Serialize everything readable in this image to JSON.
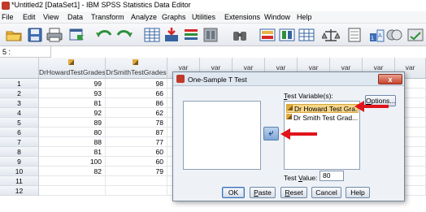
{
  "window": {
    "title": "*Untitled2 [DataSet1] - IBM SPSS Statistics Data Editor"
  },
  "menu": [
    "File",
    "Edit",
    "View",
    "Data",
    "Transform",
    "Analyze",
    "Graphs",
    "Utilities",
    "Extensions",
    "Window",
    "Help"
  ],
  "toolbar_icons": [
    "open-folder-icon",
    "save-icon",
    "print-icon",
    "recall-dialog-icon",
    "undo-icon",
    "redo-icon",
    "goto-case-icon",
    "goto-variable-icon",
    "variables-icon",
    "run-descriptives-icon",
    "find-icon",
    "insert-cases-icon",
    "insert-variable-icon",
    "split-file-icon",
    "weight-cases-icon",
    "select-cases-icon",
    "value-labels-icon",
    "use-sets-icon",
    "spelling-icon"
  ],
  "cellbar": {
    "ref": "5 :",
    "value": ""
  },
  "grid": {
    "columns": [
      "DrHowardTestGrades",
      "DrSmithTestGrades",
      "var",
      "var",
      "var",
      "var",
      "var",
      "var",
      "var",
      "var",
      "var"
    ],
    "rows": [
      {
        "n": "1",
        "a": "99",
        "b": "98"
      },
      {
        "n": "2",
        "a": "93",
        "b": "66"
      },
      {
        "n": "3",
        "a": "81",
        "b": "86"
      },
      {
        "n": "4",
        "a": "92",
        "b": "62"
      },
      {
        "n": "5",
        "a": "89",
        "b": "78"
      },
      {
        "n": "6",
        "a": "80",
        "b": "87"
      },
      {
        "n": "7",
        "a": "88",
        "b": "77"
      },
      {
        "n": "8",
        "a": "81",
        "b": "60"
      },
      {
        "n": "9",
        "a": "100",
        "b": "60"
      },
      {
        "n": "10",
        "a": "82",
        "b": "79"
      },
      {
        "n": "11",
        "a": "",
        "b": ""
      },
      {
        "n": "12",
        "a": "",
        "b": ""
      }
    ]
  },
  "dialog": {
    "title": "One-Sample T Test",
    "close": "x",
    "test_variables_label": "Test Variable(s):",
    "test_variables": [
      "Dr Howard Test Gra...",
      "Dr Smith Test Grad..."
    ],
    "selected_index": 0,
    "options_label": "Options...",
    "test_value_label": "Test Value:",
    "test_value": "80",
    "buttons": [
      "OK",
      "Paste",
      "Reset",
      "Cancel",
      "Help"
    ]
  },
  "annotation_color": "#e0141c"
}
